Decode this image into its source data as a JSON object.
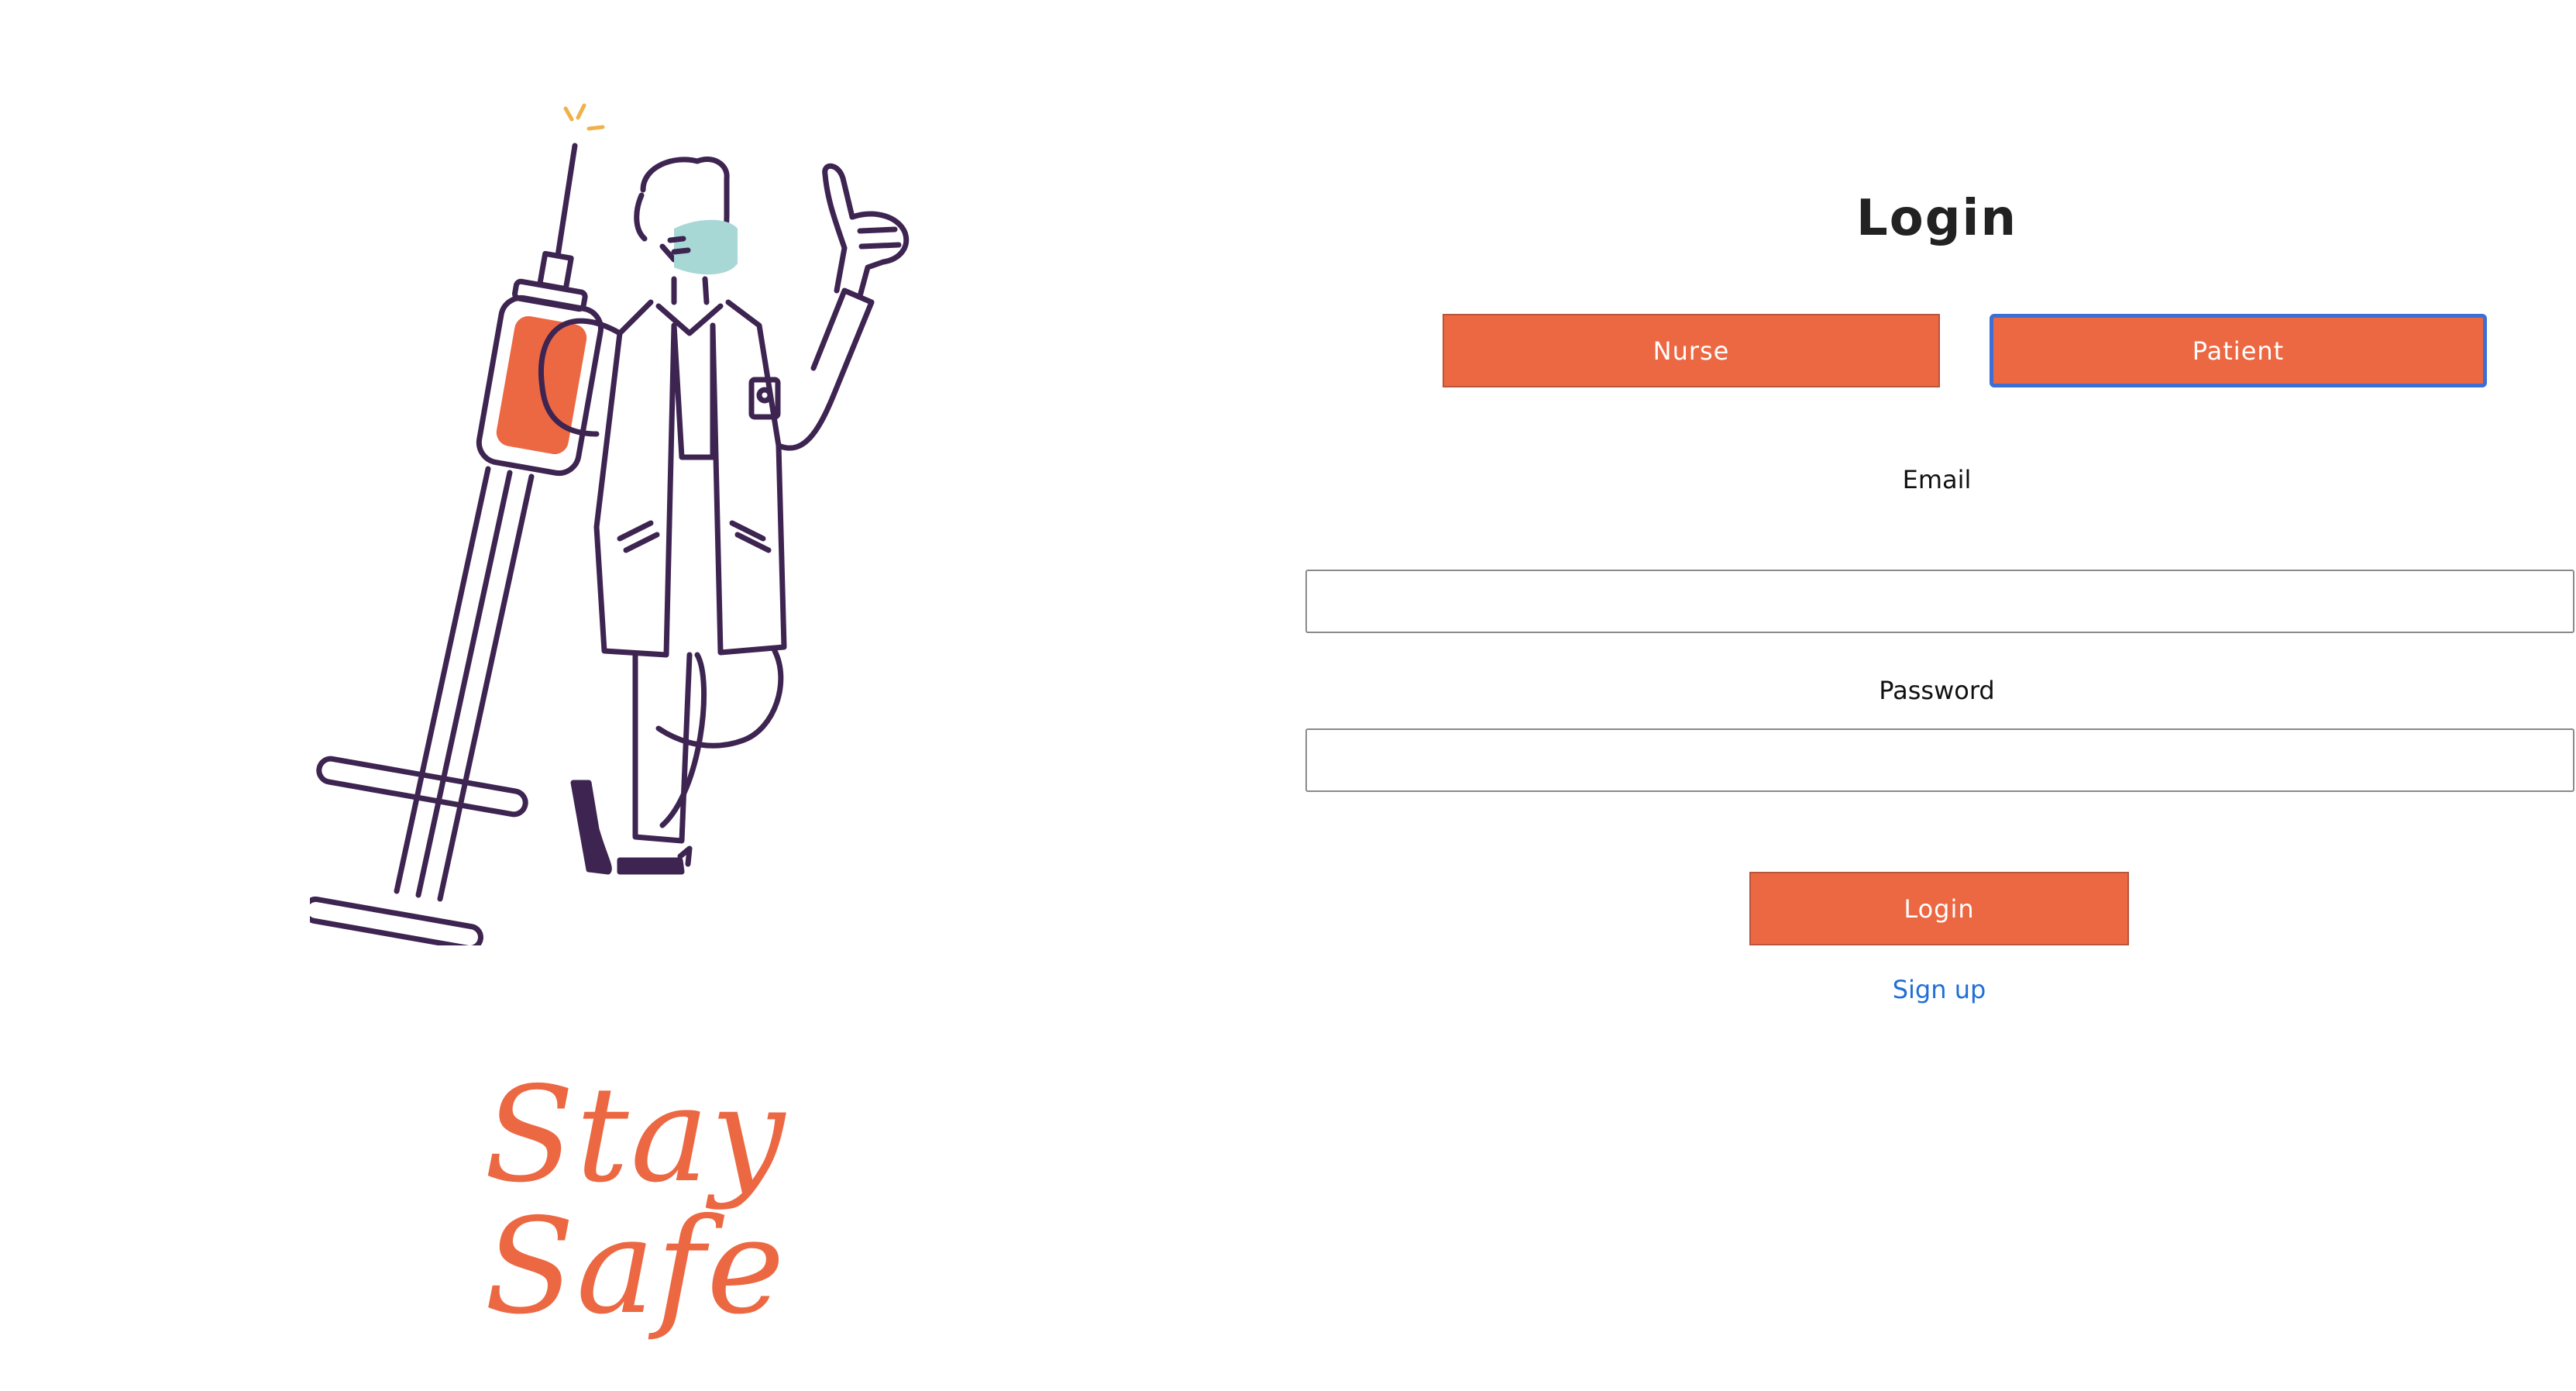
{
  "illustration": {
    "tagline": "Stay Safe"
  },
  "login": {
    "title": "Login",
    "role_buttons": {
      "nurse": "Nurse",
      "patient": "Patient"
    },
    "email": {
      "label": "Email",
      "value": "",
      "placeholder": ""
    },
    "password": {
      "label": "Password",
      "value": "",
      "placeholder": ""
    },
    "submit_label": "Login",
    "signup_link": "Sign up"
  },
  "colors": {
    "accent": "#ec6843",
    "link": "#1f6fd6",
    "focus_ring": "#3b6fd4",
    "outline": "#3d2451",
    "mask": "#a8d8d6",
    "spark": "#f0b14a"
  }
}
